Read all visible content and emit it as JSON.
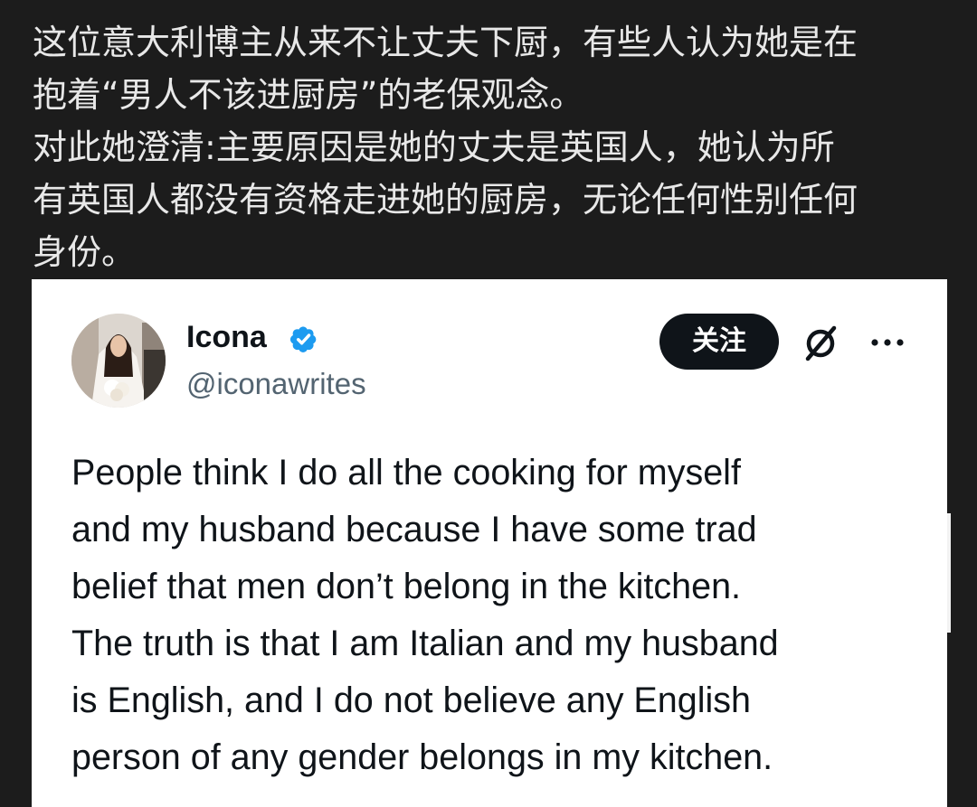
{
  "caption": {
    "line1": "这位意大利博主从来不让丈夫下厨，有些人认为她是在",
    "line2": "抱着“男人不该进厨房”的老保观念。",
    "line3": "对此她澄清:主要原因是她的丈夫是英国人，她认为所",
    "line4": "有英国人都没有资格走进她的厨房，无论任何性别任何",
    "line5": "身份。"
  },
  "tweet": {
    "display_name": "Icona",
    "handle": "@iconawrites",
    "follow_label": "关注",
    "verified": true,
    "icons": {
      "verified": "verified-badge-icon",
      "grok": "grok-icon",
      "more": "more-icon"
    },
    "text_lines": [
      "People think I do all the cooking for myself",
      "and my husband because I have some trad",
      "belief that men don’t belong in the kitchen.",
      "The truth is that I am Italian and my husband",
      "is English, and I do not believe any English",
      "person of any gender belongs in my kitchen."
    ]
  },
  "colors": {
    "background": "#1c1c1c",
    "caption_text": "#e8e8e8",
    "card": "#ffffff",
    "name_text": "#0f1419",
    "handle_text": "#536471",
    "verified_blue": "#1d9bf0",
    "follow_button": "#0f1419"
  }
}
